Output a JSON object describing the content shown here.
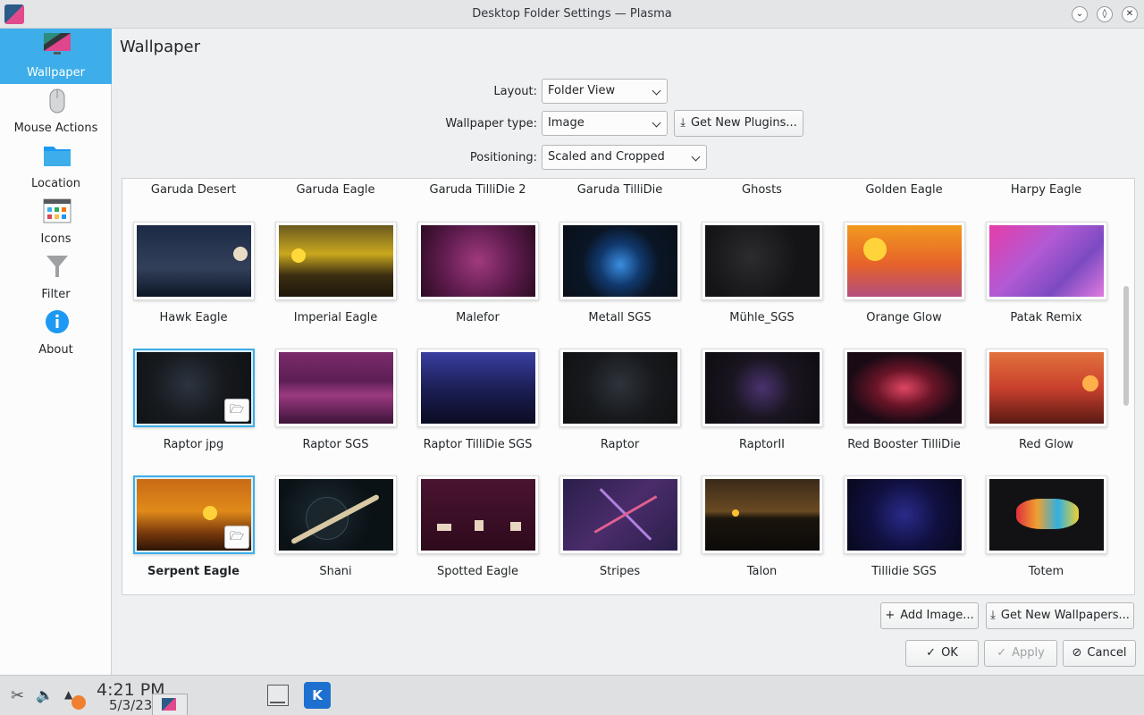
{
  "window": {
    "title": "Desktop Folder Settings — Plasma",
    "controls": [
      "minimize",
      "maximize",
      "close"
    ]
  },
  "sidebar": {
    "items": [
      {
        "label": "Wallpaper",
        "icon": "wallpaper-icon",
        "active": true
      },
      {
        "label": "Mouse Actions",
        "icon": "mouse-icon",
        "active": false
      },
      {
        "label": "Location",
        "icon": "folder-icon",
        "active": false
      },
      {
        "label": "Icons",
        "icon": "icons-icon",
        "active": false
      },
      {
        "label": "Filter",
        "icon": "filter-icon",
        "active": false
      },
      {
        "label": "About",
        "icon": "info-icon",
        "active": false
      }
    ]
  },
  "page": {
    "title": "Wallpaper"
  },
  "form": {
    "layout": {
      "label": "Layout:",
      "value": "Folder View"
    },
    "wallpaper_type": {
      "label": "Wallpaper type:",
      "value": "Image"
    },
    "get_new_plugins": "Get New Plugins...",
    "positioning": {
      "label": "Positioning:",
      "value": "Scaled and Cropped"
    }
  },
  "wallpapers": {
    "top_partial_row": [
      "Garuda Desert",
      "Garuda Eagle",
      "Garuda TilliDie 2",
      "Garuda TilliDie",
      "Ghosts",
      "Golden Eagle",
      "Harpy Eagle"
    ],
    "rows": [
      [
        "Hawk Eagle",
        "Imperial Eagle",
        "Malefor",
        "Metall SGS",
        "Mühle_SGS",
        "Orange Glow",
        "Patak Remix"
      ],
      [
        "Raptor jpg",
        "Raptor SGS",
        "Raptor TilliDie SGS",
        "Raptor",
        "RaptorII",
        "Red Booster TilliDie",
        "Red Glow"
      ],
      [
        "Serpent Eagle",
        "Shani",
        "Spotted Eagle",
        "Stripes",
        "Talon",
        "Tillidie SGS",
        "Totem"
      ]
    ],
    "selected": "Serpent Eagle",
    "highlighted": "Raptor jpg"
  },
  "actions": {
    "add_image": "Add Image...",
    "get_new_wallpapers": "Get New Wallpapers...",
    "ok": "OK",
    "apply": "Apply",
    "cancel": "Cancel"
  },
  "taskbar": {
    "time": "4:21 PM",
    "date": "5/3/23"
  }
}
